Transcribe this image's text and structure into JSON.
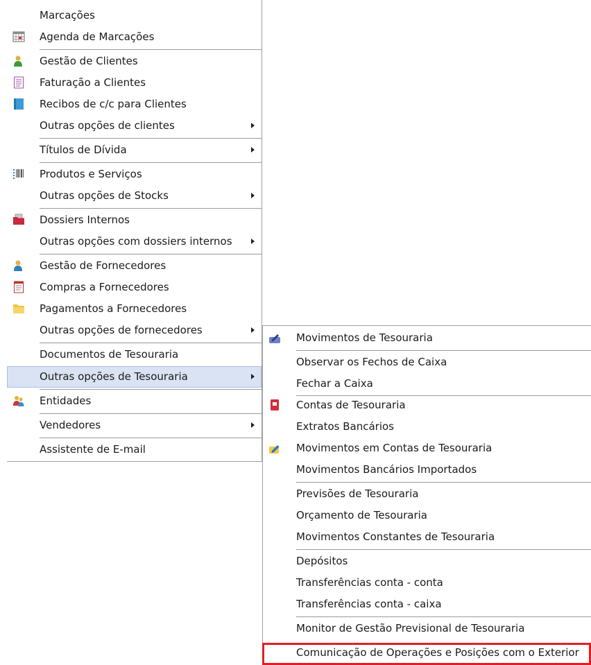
{
  "main_menu": {
    "items": [
      {
        "label": "Marcações"
      },
      {
        "label": "Agenda de Marcações",
        "icon": "calendar-grid-icon"
      },
      {
        "label": "Gestão de Clientes",
        "icon": "client-person-icon"
      },
      {
        "label": "Faturação a Clientes",
        "icon": "invoice-document-icon"
      },
      {
        "label": "Recibos de c/c para Clientes",
        "icon": "receipt-book-icon"
      },
      {
        "label": "Outras opções de clientes"
      },
      {
        "label": "Títulos de Dívida"
      },
      {
        "label": "Produtos e Serviços",
        "icon": "barcode-icon"
      },
      {
        "label": "Outras opções de Stocks"
      },
      {
        "label": "Dossiers Internos",
        "icon": "red-folder-icon"
      },
      {
        "label": "Outras opções com dossiers internos"
      },
      {
        "label": "Gestão de Fornecedores",
        "icon": "supplier-person-icon"
      },
      {
        "label": "Compras a Fornecedores",
        "icon": "purchase-document-icon"
      },
      {
        "label": "Pagamentos a Fornecedores",
        "icon": "yellow-folder-icon"
      },
      {
        "label": "Outras opções de fornecedores"
      },
      {
        "label": "Documentos de Tesouraria"
      },
      {
        "label": "Outras opções de Tesouraria"
      },
      {
        "label": "Entidades",
        "icon": "entities-people-icon"
      },
      {
        "label": "Vendedores"
      },
      {
        "label": "Assistente de E-mail"
      }
    ]
  },
  "sub_menu": {
    "items": [
      {
        "label": "Movimentos de Tesouraria",
        "icon": "treasury-pencil-icon"
      },
      {
        "label": "Observar os Fechos de Caixa"
      },
      {
        "label": "Fechar a Caixa"
      },
      {
        "label": "Contas de Tesouraria",
        "icon": "treasury-accounts-icon"
      },
      {
        "label": "Extratos Bancários"
      },
      {
        "label": "Movimentos em Contas de Tesouraria",
        "icon": "account-movements-icon"
      },
      {
        "label": "Movimentos Bancários Importados"
      },
      {
        "label": "Previsões de Tesouraria"
      },
      {
        "label": "Orçamento de Tesouraria"
      },
      {
        "label": "Movimentos Constantes de Tesouraria"
      },
      {
        "label": "Depósitos"
      },
      {
        "label": "Transferências conta - conta"
      },
      {
        "label": "Transferências conta - caixa"
      },
      {
        "label": "Monitor de Gestão Previsional de Tesouraria"
      },
      {
        "label": "Comunicação de Operações e Posições com o Exterior"
      }
    ]
  },
  "colors": {
    "highlight": "#d9e3f3",
    "annotation_box": "#e21e25"
  }
}
